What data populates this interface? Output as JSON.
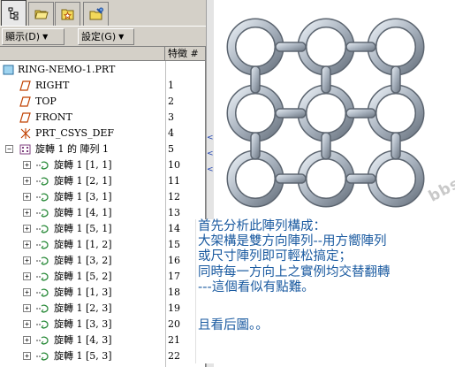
{
  "toolbar": {
    "display_menu": "顯示(D)",
    "settings_menu": "設定(G)"
  },
  "tree": {
    "column_feature_id": "特徵 #",
    "items": [
      {
        "label": "RING-NEMO-1.PRT",
        "num": ""
      },
      {
        "label": "RIGHT",
        "num": "1"
      },
      {
        "label": "TOP",
        "num": "2"
      },
      {
        "label": "FRONT",
        "num": "3"
      },
      {
        "label": "PRT_CSYS_DEF",
        "num": "4"
      },
      {
        "label": "旋轉 1 的 陣列 1",
        "num": "5"
      },
      {
        "label": "旋轉 1 [1, 1]",
        "num": "10"
      },
      {
        "label": "旋轉 1 [2, 1]",
        "num": "11"
      },
      {
        "label": "旋轉 1 [3, 1]",
        "num": "12"
      },
      {
        "label": "旋轉 1 [4, 1]",
        "num": "13"
      },
      {
        "label": "旋轉 1 [5, 1]",
        "num": "14"
      },
      {
        "label": "旋轉 1 [1, 2]",
        "num": "15"
      },
      {
        "label": "旋轉 1 [3, 2]",
        "num": "16"
      },
      {
        "label": "旋轉 1 [5, 2]",
        "num": "17"
      },
      {
        "label": "旋轉 1 [1, 3]",
        "num": "18"
      },
      {
        "label": "旋轉 1 [2, 3]",
        "num": "19"
      },
      {
        "label": "旋轉 1 [3, 3]",
        "num": "20"
      },
      {
        "label": "旋轉 1 [4, 3]",
        "num": "21"
      },
      {
        "label": "旋轉 1 [5, 3]",
        "num": "22"
      }
    ]
  },
  "watermark": "bbs.chinade.net",
  "note": {
    "lines": [
      "首先分析此陣列構成：",
      "大架構是雙方向陣列--用方嚮陣列",
      "或尺寸陣列即可輕松搞定；",
      "同時每一方向上之實例均交替翻轉",
      "---這個看似有點難。",
      "",
      "且看后圖。。"
    ]
  },
  "colors": {
    "panel": "#d4d0c8",
    "note_text": "#1a5aa0",
    "ring": "#aab4c0"
  },
  "icons": {
    "tabs": [
      "model-tree-icon",
      "folder-icon",
      "star-folder-icon",
      "folder-tools-icon"
    ]
  }
}
